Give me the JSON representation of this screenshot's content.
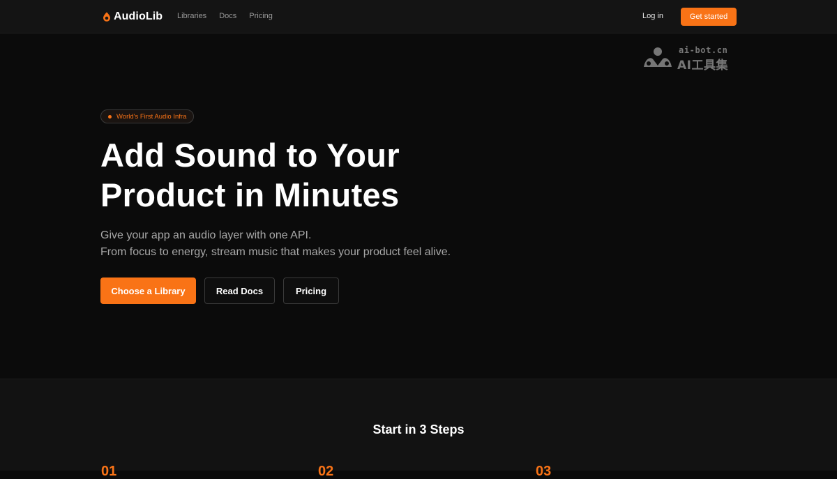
{
  "nav": {
    "brand": "AudioLib",
    "links": [
      "Libraries",
      "Docs",
      "Pricing"
    ],
    "login": "Log in",
    "get_started": "Get started"
  },
  "watermark": {
    "line1": "ai-bot.cn",
    "line2": "AI工具集"
  },
  "hero": {
    "badge": "World's First Audio Infra",
    "headline_line1": "Add Sound to Your",
    "headline_line2": "Product in Minutes",
    "sub_line1": "Give your app an audio layer with one API.",
    "sub_line2": "From focus to energy, stream music that makes your product feel alive.",
    "cta_primary": "Choose a Library",
    "cta_docs": "Read Docs",
    "cta_pricing": "Pricing"
  },
  "steps": {
    "title": "Start in 3 Steps",
    "numbers": [
      "01",
      "02",
      "03"
    ]
  },
  "colors": {
    "accent": "#f97316",
    "background": "#0b0b0b",
    "nav_background": "#141414"
  },
  "icons": {
    "brand": "flame-drop-icon",
    "watermark": "ai-bot-logo-icon"
  }
}
